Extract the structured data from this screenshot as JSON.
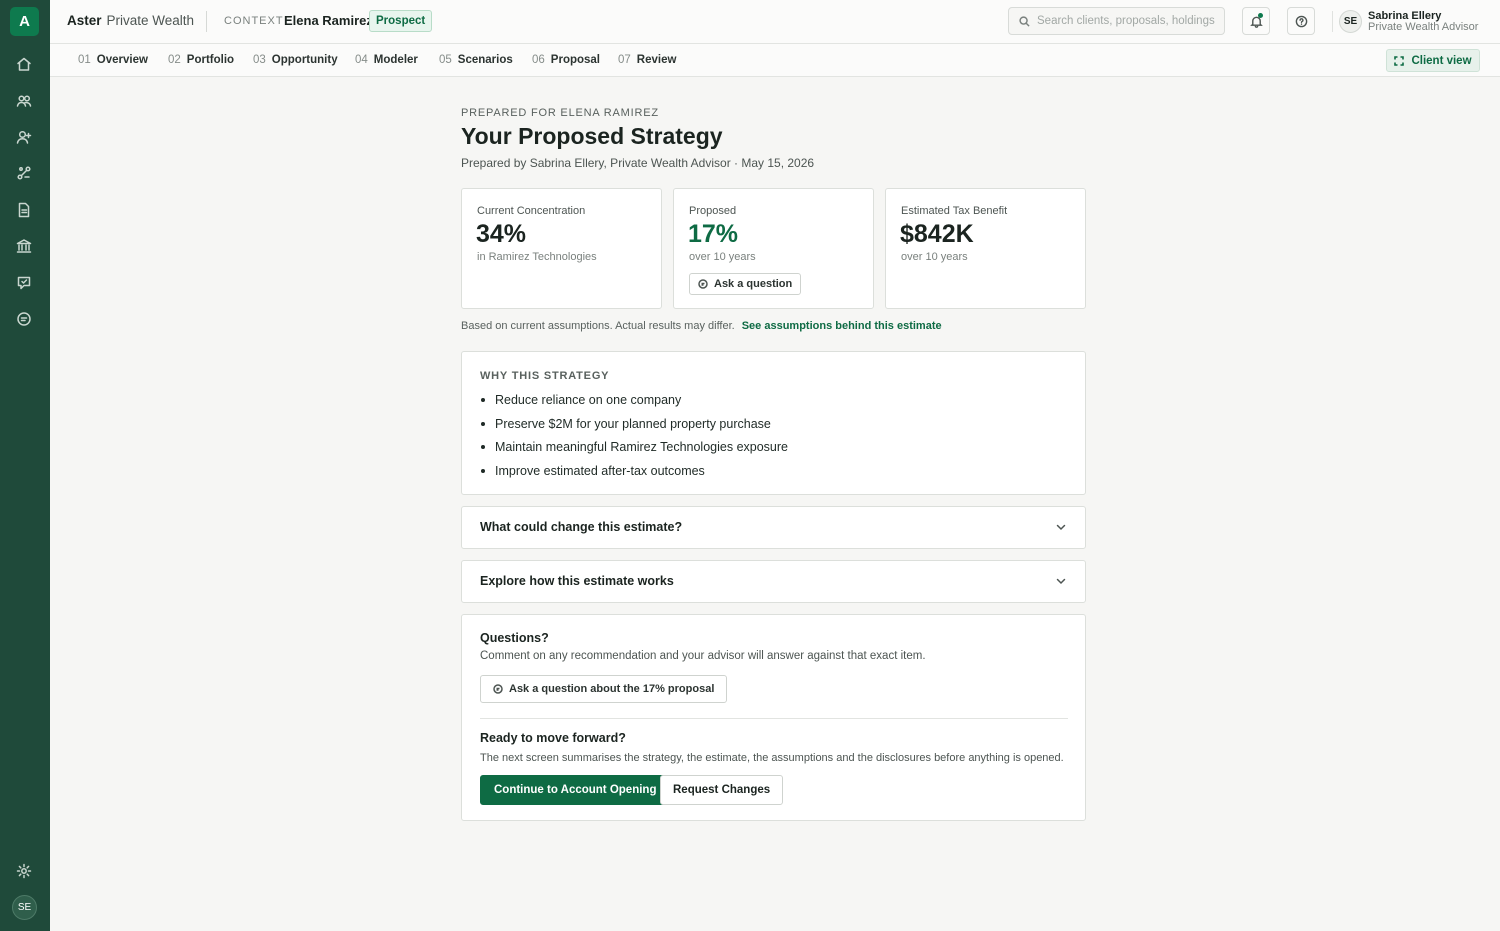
{
  "app": {
    "logo_letter": "A",
    "brand_name": "Aster",
    "brand_sub": "Private Wealth"
  },
  "context": {
    "label": "CONTEXT",
    "client_name": "Elena Ramirez",
    "status_badge": "Prospect"
  },
  "search": {
    "placeholder": "Search clients, proposals, holdings"
  },
  "user": {
    "initials": "SE",
    "name": "Sabrina Ellery",
    "role": "Private Wealth Advisor"
  },
  "sidebar": {
    "items": [
      {
        "icon": "home-icon"
      },
      {
        "icon": "clients-icon"
      },
      {
        "icon": "add-user-icon"
      },
      {
        "icon": "scenarios-icon"
      },
      {
        "icon": "document-icon"
      },
      {
        "icon": "bank-icon"
      },
      {
        "icon": "review-icon"
      },
      {
        "icon": "chat-icon"
      }
    ],
    "settings_icon": "gear-icon",
    "avatar_initials": "SE"
  },
  "steps": [
    {
      "num": "01",
      "label": "Overview"
    },
    {
      "num": "02",
      "label": "Portfolio"
    },
    {
      "num": "03",
      "label": "Opportunity"
    },
    {
      "num": "04",
      "label": "Modeler"
    },
    {
      "num": "05",
      "label": "Scenarios"
    },
    {
      "num": "06",
      "label": "Proposal"
    },
    {
      "num": "07",
      "label": "Review"
    }
  ],
  "client_view_label": "Client view",
  "proposal": {
    "eyebrow": "Prepared for Elena Ramirez",
    "title": "Your Proposed Strategy",
    "prepared_by": "Prepared by Sabrina Ellery, Private Wealth Advisor · May 15, 2026",
    "cards": [
      {
        "label": "Current Concentration",
        "value": "34%",
        "sub": "in Ramirez Technologies"
      },
      {
        "label": "Proposed",
        "value": "17%",
        "sub": "over 10 years",
        "action": "Ask a question"
      },
      {
        "label": "Estimated Tax Benefit",
        "value": "$842K",
        "sub": "over 10 years"
      }
    ],
    "disclaimer": "Based on current assumptions. Actual results may differ.",
    "assumptions_link": "See assumptions behind this estimate",
    "why": {
      "title": "WHY THIS STRATEGY",
      "items": [
        "Reduce reliance on one company",
        "Preserve $2M for your planned property purchase",
        "Maintain meaningful Ramirez Technologies exposure",
        "Improve estimated after-tax outcomes"
      ]
    },
    "accordions": [
      {
        "title": "What could change this estimate?"
      },
      {
        "title": "Explore how this estimate works"
      }
    ],
    "questions": {
      "title": "Questions?",
      "sub": "Comment on any recommendation and your advisor will answer against that exact item.",
      "button": "Ask a question about the 17% proposal"
    },
    "ready": {
      "title": "Ready to move forward?",
      "sub": "The next screen summarises the strategy, the estimate, the assumptions and the disclosures before anything is opened.",
      "primary": "Continue to Account Opening",
      "secondary": "Request Changes"
    }
  },
  "colors": {
    "sidebar": "#1f4a3a",
    "accent": "#0e6b44",
    "background": "#f6f6f4"
  }
}
